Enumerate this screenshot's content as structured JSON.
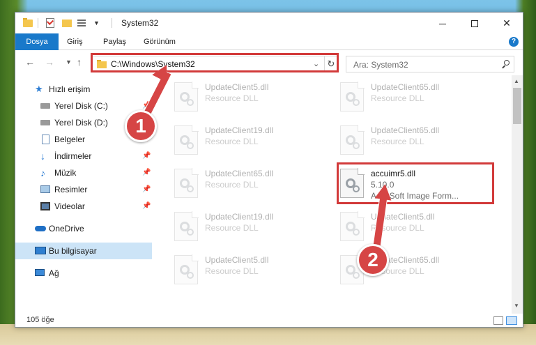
{
  "window": {
    "title": "System32"
  },
  "ribbon": {
    "tabs": [
      "Dosya",
      "Giriş",
      "Paylaş",
      "Görünüm"
    ],
    "help": "?"
  },
  "nav": {
    "path": "C:\\Windows\\System32",
    "search_placeholder": "Ara: System32"
  },
  "sidebar": {
    "items": [
      {
        "label": "Hızlı erişim",
        "icon": "star-icon"
      },
      {
        "label": "Yerel Disk (C:)",
        "icon": "drive-icon"
      },
      {
        "label": "Yerel Disk (D:)",
        "icon": "drive-icon"
      },
      {
        "label": "Belgeler",
        "icon": "documents-icon"
      },
      {
        "label": "İndirmeler",
        "icon": "download-icon"
      },
      {
        "label": "Müzik",
        "icon": "music-icon"
      },
      {
        "label": "Resimler",
        "icon": "pictures-icon"
      },
      {
        "label": "Videolar",
        "icon": "video-icon"
      },
      {
        "label": "OneDrive",
        "icon": "cloud-icon"
      },
      {
        "label": "Bu bilgisayar",
        "icon": "computer-icon"
      },
      {
        "label": "Ağ",
        "icon": "network-icon"
      }
    ],
    "selected": "Bu bilgisayar"
  },
  "files": [
    {
      "name": "UpdateClient5.dll",
      "desc": "Resource DLL"
    },
    {
      "name": "UpdateClient65.dll",
      "desc": "Resource DLL"
    },
    {
      "name": "UpdateClient19.dll",
      "desc": "Resource DLL"
    },
    {
      "name": "UpdateClient65.dll",
      "desc": "Resource DLL"
    },
    {
      "name": "UpdateClient65.dll",
      "desc": "Resource DLL"
    },
    {
      "name": "accuimr5.dll",
      "version": "5.10.0",
      "desc": "AccuSoft Image Form..."
    },
    {
      "name": "UpdateClient19.dll",
      "desc": "Resource DLL"
    },
    {
      "name": "UpdateClient5.dll",
      "desc": "Resource DLL"
    },
    {
      "name": "UpdateClient5.dll",
      "desc": "Resource DLL"
    },
    {
      "name": "UpdateClient65.dll",
      "desc": "Resource DLL"
    }
  ],
  "status": {
    "count": "105 öğe"
  },
  "annotations": {
    "step1": "1",
    "step2": "2",
    "color": "#d64545"
  }
}
